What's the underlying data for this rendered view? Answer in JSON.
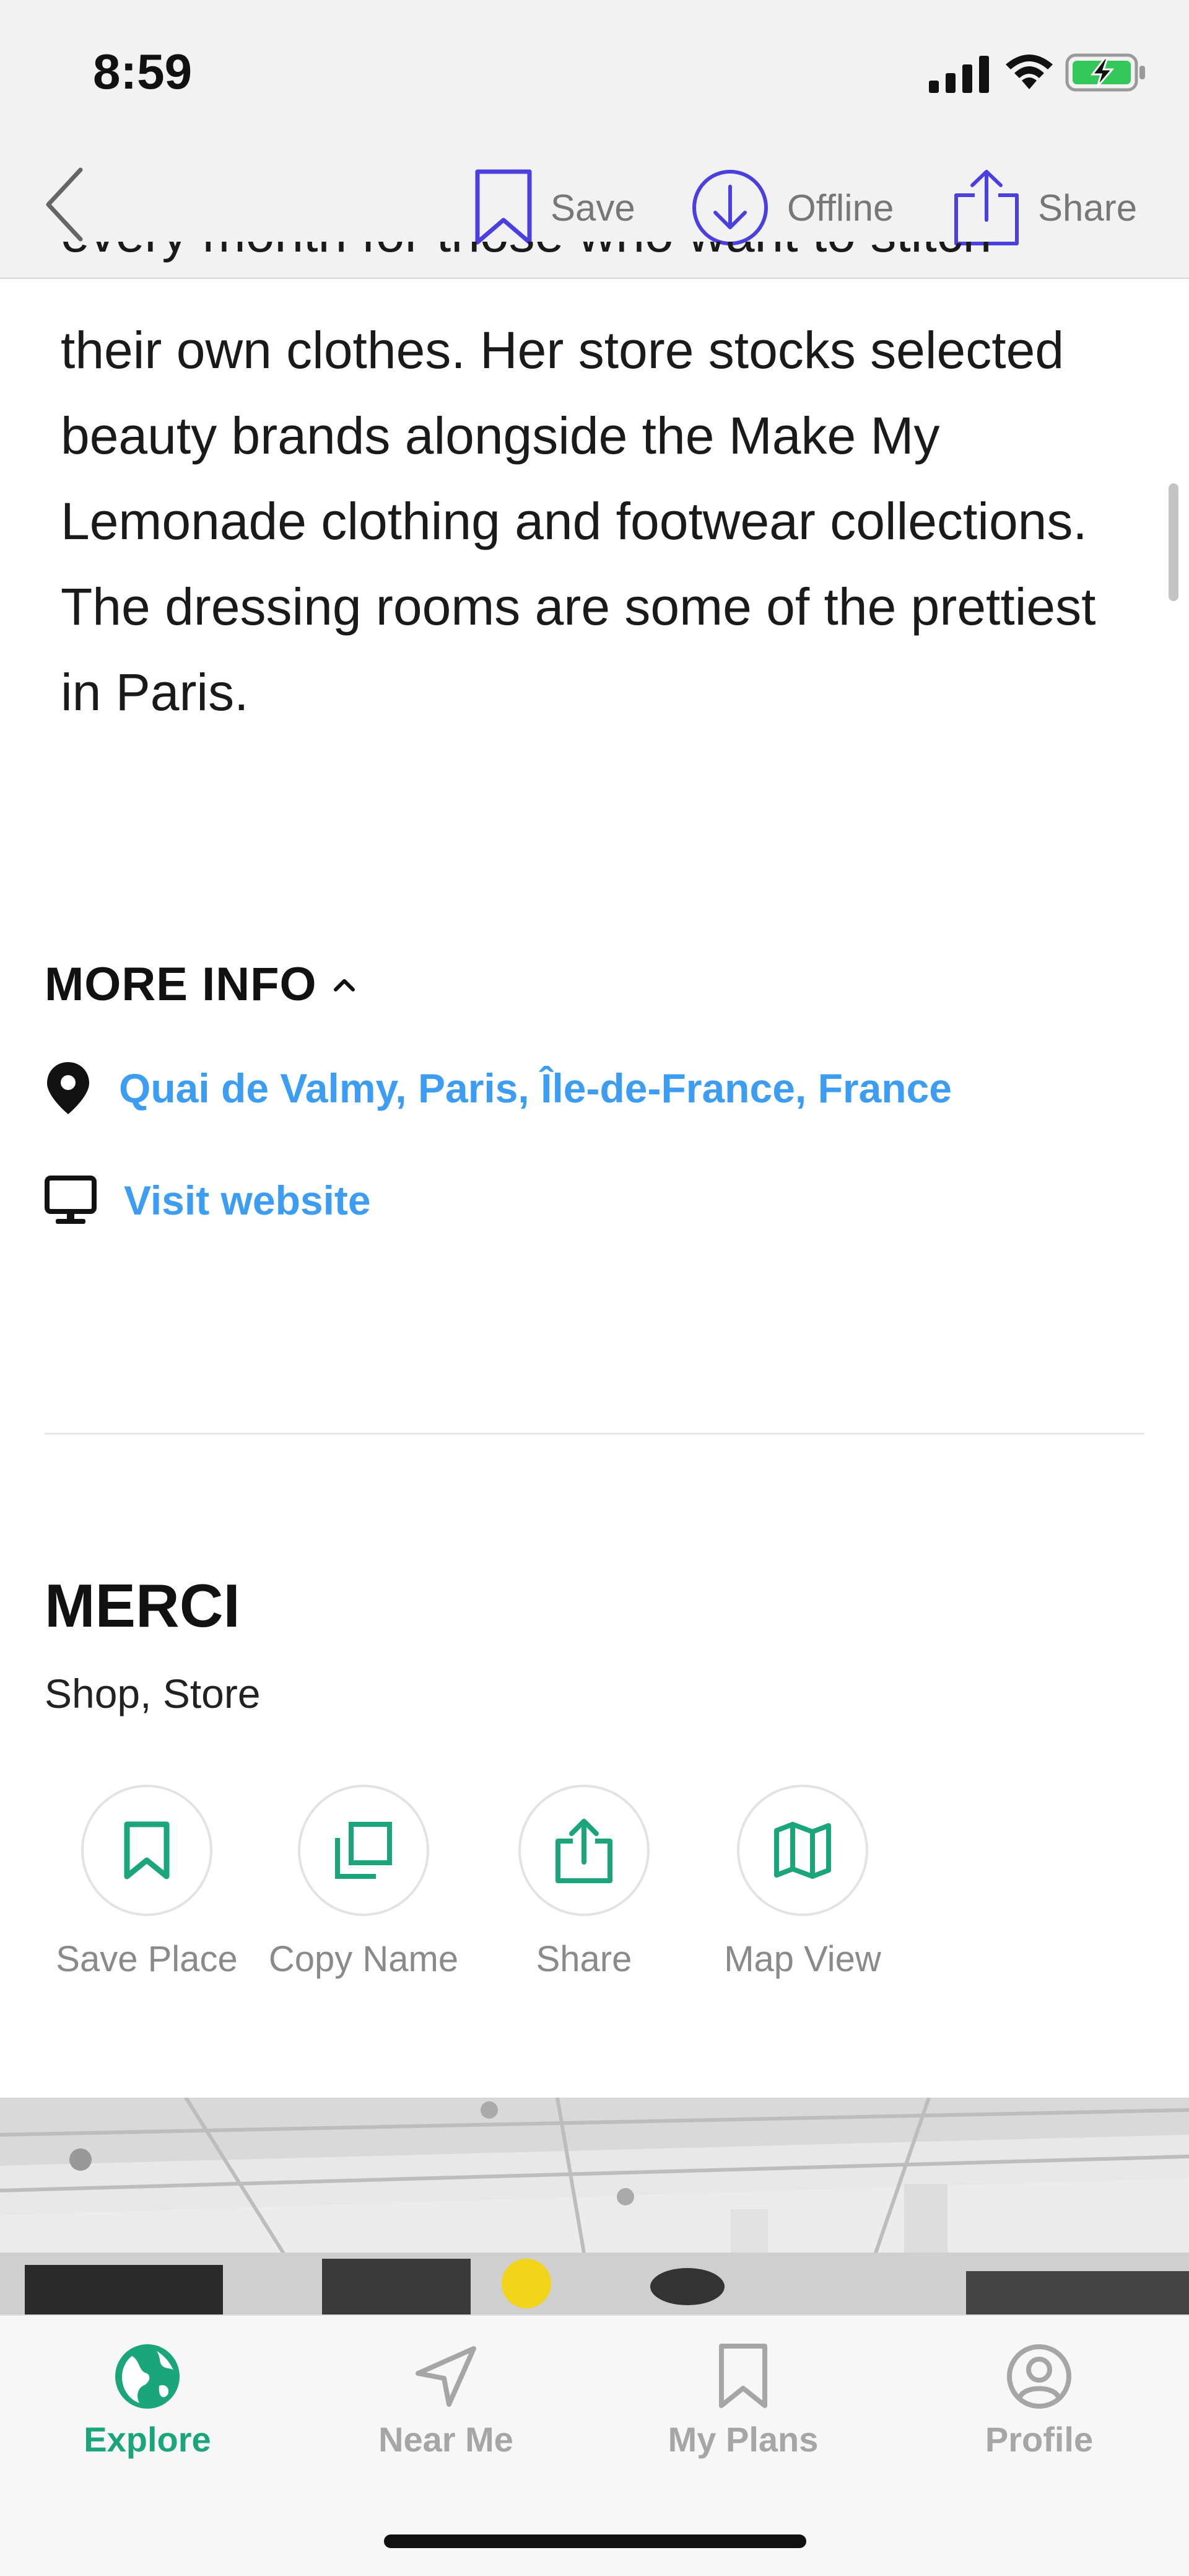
{
  "status_bar": {
    "time": "8:59"
  },
  "header": {
    "save_label": "Save",
    "offline_label": "Offline",
    "share_label": "Share"
  },
  "article": {
    "cut_line": "every month for those who want to stitch",
    "paragraph": "their own clothes. Her store stocks selected beauty brands alongside the Make My Lemonade clothing and footwear collections. The dressing rooms are some of the prettiest in Paris."
  },
  "more_info": {
    "heading": "MORE INFO",
    "address": "Quai de Valmy, Paris, Île-de-France, France",
    "website": "Visit website"
  },
  "place": {
    "name": "MERCI",
    "type": "Shop, Store",
    "actions": [
      {
        "label": "Save Place",
        "icon": "bookmark-icon"
      },
      {
        "label": "Copy Name",
        "icon": "copy-icon"
      },
      {
        "label": "Share",
        "icon": "share-icon"
      },
      {
        "label": "Map View",
        "icon": "map-icon"
      }
    ]
  },
  "tabs": [
    {
      "label": "Explore",
      "icon": "globe-icon",
      "active": true
    },
    {
      "label": "Near Me",
      "icon": "navigation-arrow-icon",
      "active": false
    },
    {
      "label": "My Plans",
      "icon": "bookmark-icon",
      "active": false
    },
    {
      "label": "Profile",
      "icon": "user-circle-icon",
      "active": false
    }
  ],
  "colors": {
    "accent_green": "#1aa67a",
    "link_blue": "#3c9df2",
    "header_purple": "#4b3fe0",
    "tab_inactive": "#a6a6a6"
  }
}
